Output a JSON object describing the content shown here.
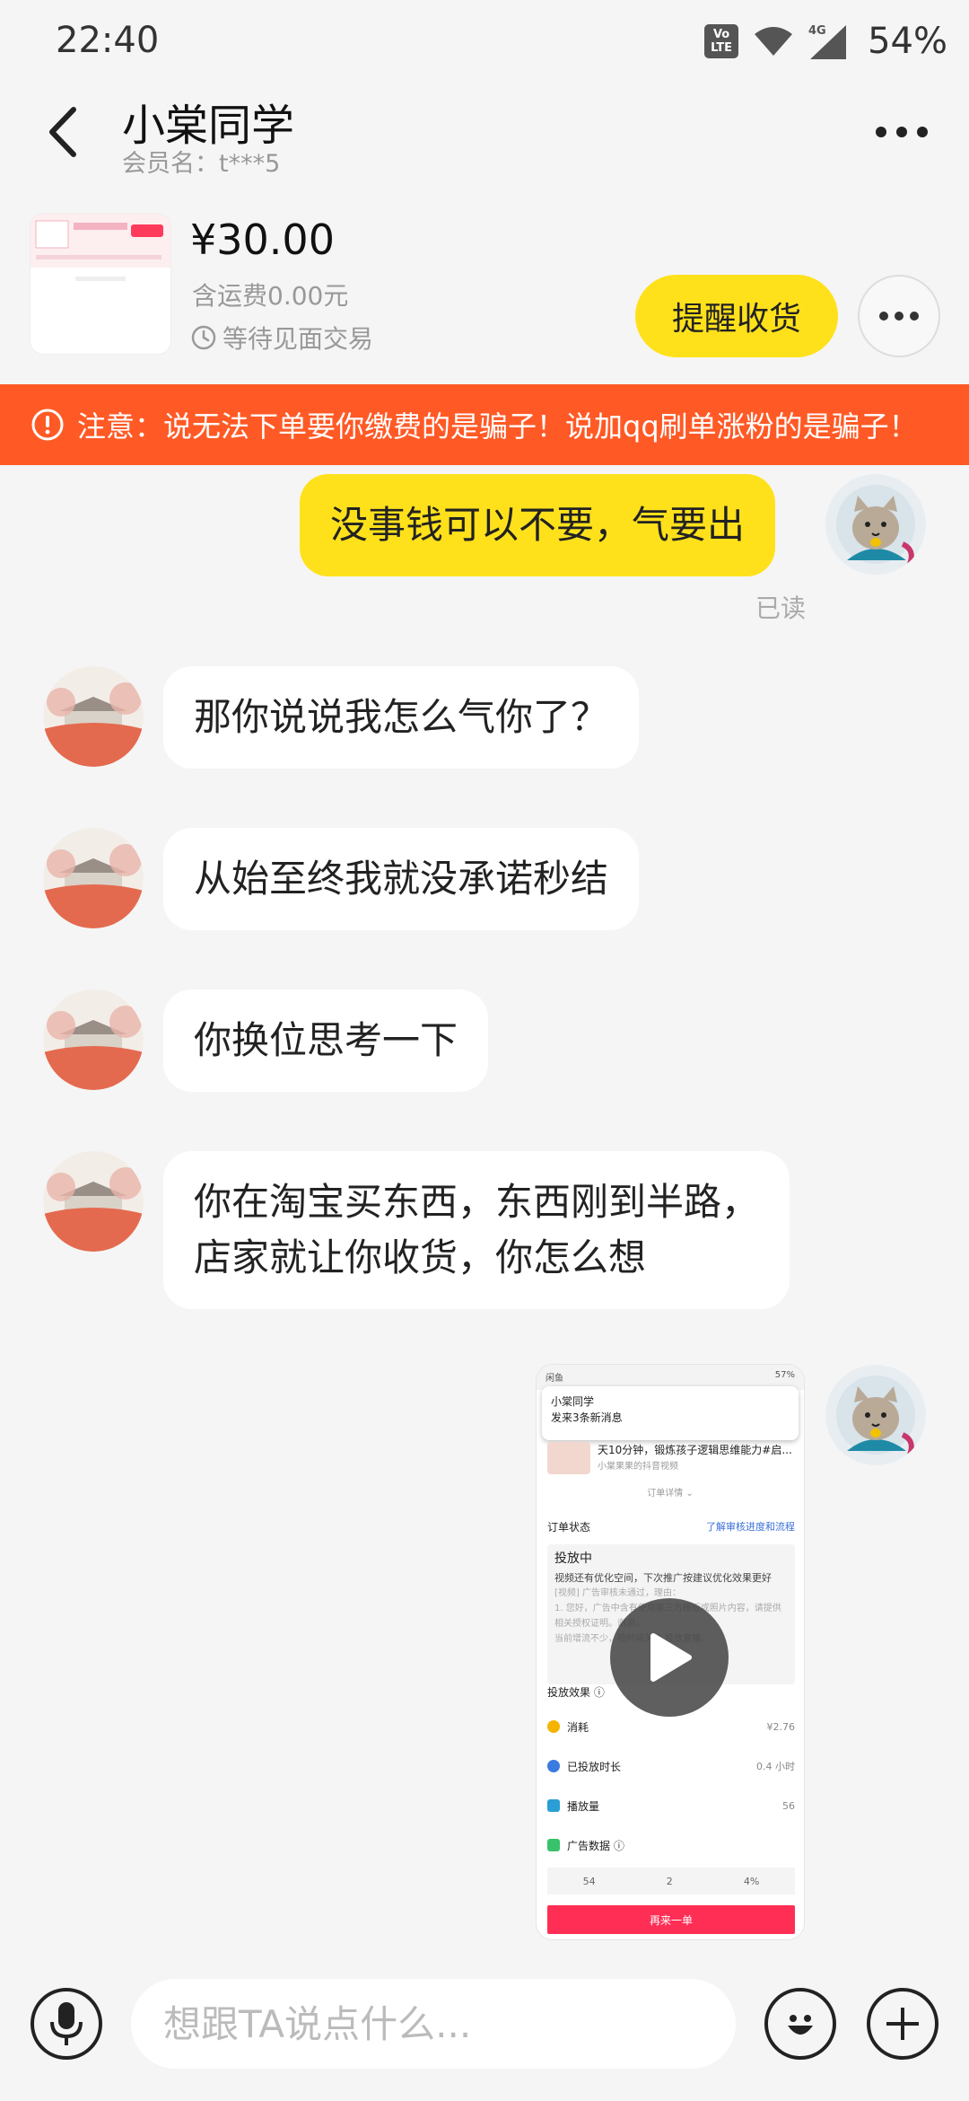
{
  "status_bar": {
    "time": "22:40",
    "battery": "54%",
    "volte": "Vo LTE",
    "network": "4G"
  },
  "header": {
    "title": "小棠同学",
    "member_label": "会员名：t***5"
  },
  "order": {
    "price": "¥30.00",
    "shipping": "含运费0.00元",
    "trade_status": "等待见面交易",
    "remind_button": "提醒收货"
  },
  "warning": {
    "text": "注意：说无法下单要你缴费的是骗子！说加qq刷单涨粉的是骗子！"
  },
  "messages": [
    {
      "from": "me",
      "text": "没事钱可以不要，气要出"
    },
    {
      "from": "them",
      "text": "那你说说我怎么气你了？"
    },
    {
      "from": "them",
      "text": "从始至终我就没承诺秒结"
    },
    {
      "from": "them",
      "text": "你换位思考一下"
    },
    {
      "from": "them",
      "text_line1": "你在淘宝买东西，东西刚到半路，",
      "text_line2": "店家就让你收货，你怎么想"
    }
  ],
  "read_status": "已读",
  "video_message": {
    "status_left": "闲鱼",
    "status_right": "57%",
    "notify_title": "小棠同学",
    "notify_body": "发来3条新消息",
    "course_title": "天10分钟，锻炼孩子逻辑思维能力#启...",
    "course_sub": "小棠果果的抖音视频",
    "detail_link": "订单详情 ⌄",
    "order_status_label": "订单状态",
    "order_status_link": "了解审核进度和流程",
    "box_head": "投放中",
    "box_line1": "视频还有优化空间，下次推广按建议优化效果更好",
    "box_line2": "[视频] 广告审核未通过，理由：",
    "box_line3": "1. 您好，广告中含有使用第三方模板或照片内容，请提供相关授权证明。谢谢。",
    "box_line4": "当前增流不少，按时间关注 投放直播。",
    "effect_title": "投放效果 ⓘ",
    "metrics": [
      {
        "label": "消耗",
        "value": "¥2.76",
        "color": "#f5b400"
      },
      {
        "label": "已投放时长",
        "value": "0.4 小时",
        "color": "#3a7be0"
      },
      {
        "label": "播放量",
        "value": "56",
        "color": "#2a9fd6"
      },
      {
        "label": "广告数据 ⓘ",
        "value": "",
        "color": "#37c26b"
      }
    ],
    "stats": [
      "54",
      "2",
      "4%"
    ],
    "reorder_button": "再来一单"
  },
  "input": {
    "placeholder": "想跟TA说点什么..."
  },
  "colors": {
    "accent_yellow": "#ffe11b",
    "warning_orange": "#ff5a26",
    "background": "#f5f5f5"
  }
}
